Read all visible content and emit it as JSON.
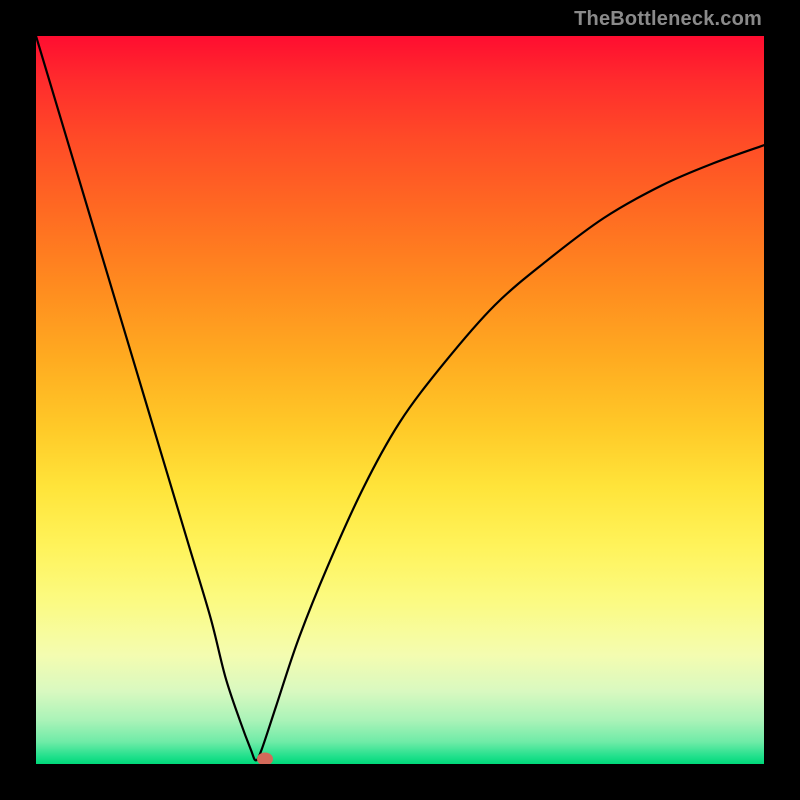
{
  "watermark": "TheBottleneck.com",
  "colors": {
    "frame": "#000000",
    "curve_stroke": "#000000",
    "dot_fill": "#d46a5a",
    "gradient_top": "#ff0d30",
    "gradient_bottom": "#00d879"
  },
  "chart_data": {
    "type": "line",
    "title": "",
    "xlabel": "",
    "ylabel": "",
    "xlim": [
      0,
      100
    ],
    "ylim": [
      0,
      100
    ],
    "grid": false,
    "legend": null,
    "note": "Background is a vertical heat gradient (red=high bottleneck at top, green=low at bottom). The curve shows bottleneck vs an implicit x-axis parameter; values below are the curve y-value (0=bottom/green, ~100=top/red) sampled at x percentages.",
    "series": [
      {
        "name": "bottleneck-curve",
        "x": [
          0,
          3,
          6,
          9,
          12,
          15,
          18,
          21,
          24,
          26,
          28,
          29.5,
          30.2,
          31,
          33,
          36,
          40,
          45,
          50,
          56,
          63,
          70,
          78,
          86,
          93,
          100
        ],
        "y": [
          100,
          90,
          80,
          70,
          60,
          50,
          40,
          30,
          20,
          12,
          6,
          2,
          0.5,
          2,
          8,
          17,
          27,
          38,
          47,
          55,
          63,
          69,
          75,
          79.5,
          82.5,
          85
        ]
      }
    ],
    "marker": {
      "name": "highlight-dot",
      "x": 31.5,
      "y": 0.7
    }
  }
}
